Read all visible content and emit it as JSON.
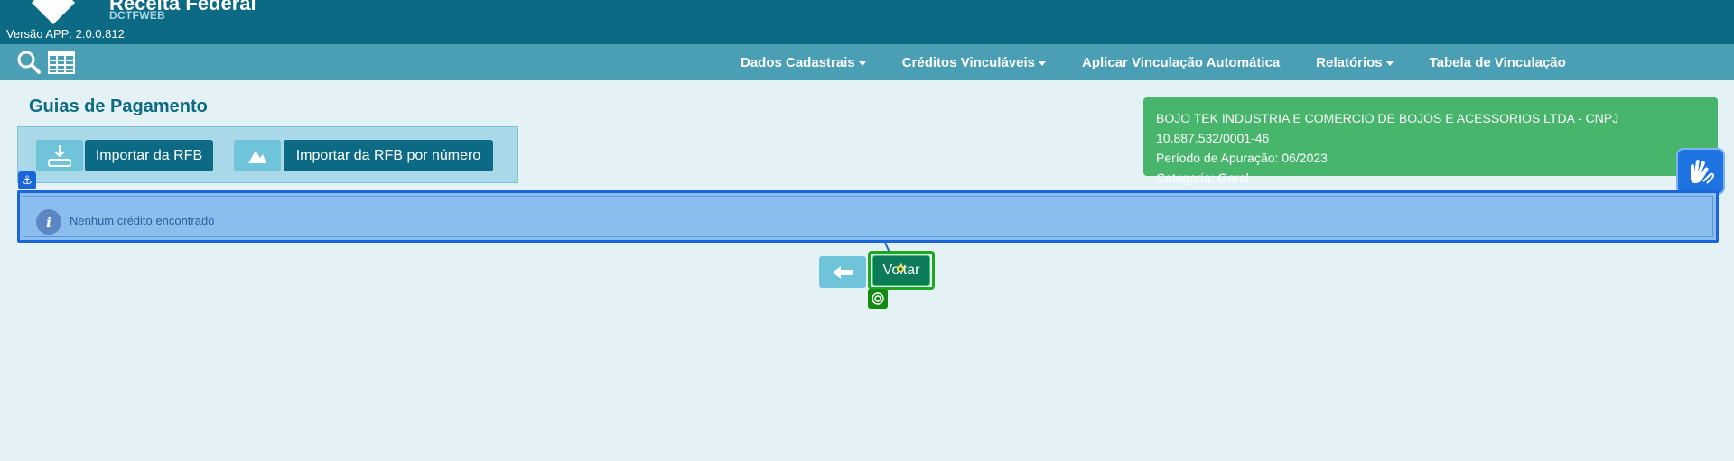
{
  "header": {
    "brand_title": "Receita Federal",
    "brand_subtitle": "DCTFWEB",
    "version": "Versão APP: 2.0.0.812"
  },
  "navbar": {
    "icons": [
      "search-icon",
      "table-icon"
    ],
    "items": [
      {
        "label": "Dados Cadastrais",
        "dropdown": true
      },
      {
        "label": "Créditos Vinculáveis",
        "dropdown": true
      },
      {
        "label": "Aplicar Vinculação Automática",
        "dropdown": false
      },
      {
        "label": "Relatórios",
        "dropdown": true
      },
      {
        "label": "Tabela de Vinculação",
        "dropdown": false
      }
    ]
  },
  "page": {
    "title": "Guias de Pagamento"
  },
  "import_panel": {
    "import_rfb_label": "Importar da RFB",
    "import_rfb_number_label": "Importar da RFB por número"
  },
  "company_info": {
    "line1": "BOJO TEK INDUSTRIA E COMERCIO DE BOJOS E ACESSORIOS LTDA - CNPJ 10.887.532/0001-46",
    "line2": "Período de Apuração: 06/2023",
    "line3": "Categoria: Geral"
  },
  "alert": {
    "message": "Nenhum crédito encontrado"
  },
  "actions": {
    "voltar_label": "Voltar"
  },
  "colors": {
    "header_bg": "#0d6a84",
    "navbar_bg": "#4a9fb5",
    "page_bg": "#e4f2f6",
    "company_bg": "#48b56c",
    "alert_bg": "#8bbdee",
    "accent_blue": "#1a66d8",
    "primary_button": "#0d6a84"
  }
}
